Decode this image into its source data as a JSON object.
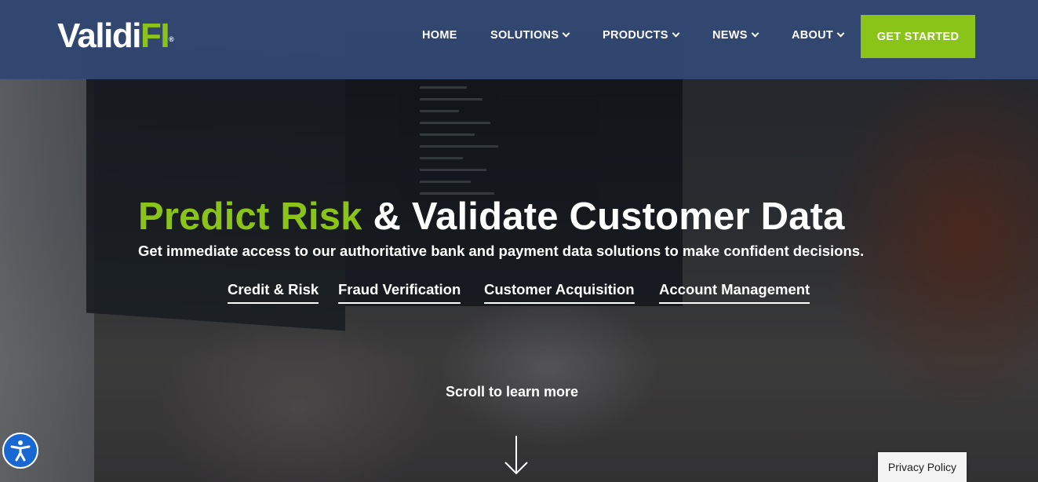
{
  "header": {
    "logo": {
      "part_white": "Validi",
      "part_green": "FI",
      "mark": "®"
    },
    "nav": [
      {
        "label": "HOME",
        "has_dropdown": false
      },
      {
        "label": "SOLUTIONS",
        "has_dropdown": true
      },
      {
        "label": "PRODUCTS",
        "has_dropdown": true
      },
      {
        "label": "NEWS",
        "has_dropdown": true
      },
      {
        "label": "ABOUT",
        "has_dropdown": true
      }
    ],
    "cta_label": "GET STARTED"
  },
  "hero": {
    "headline_highlight": "Predict Risk",
    "headline_rest": " & Validate Customer Data",
    "subheadline": "Get immediate access to our authoritative bank and payment data solutions to make confident decisions.",
    "links": [
      "Credit & Risk",
      "Fraud Verification",
      "Customer Acquisition",
      "Account Management"
    ],
    "scroll_text": "Scroll to learn more"
  },
  "widgets": {
    "accessibility_icon": "accessibility-person-icon",
    "privacy_label": "Privacy Policy"
  },
  "colors": {
    "brand_green": "#8bc418",
    "header_bg": "#344b78",
    "accessibility_blue": "#1967d2"
  }
}
